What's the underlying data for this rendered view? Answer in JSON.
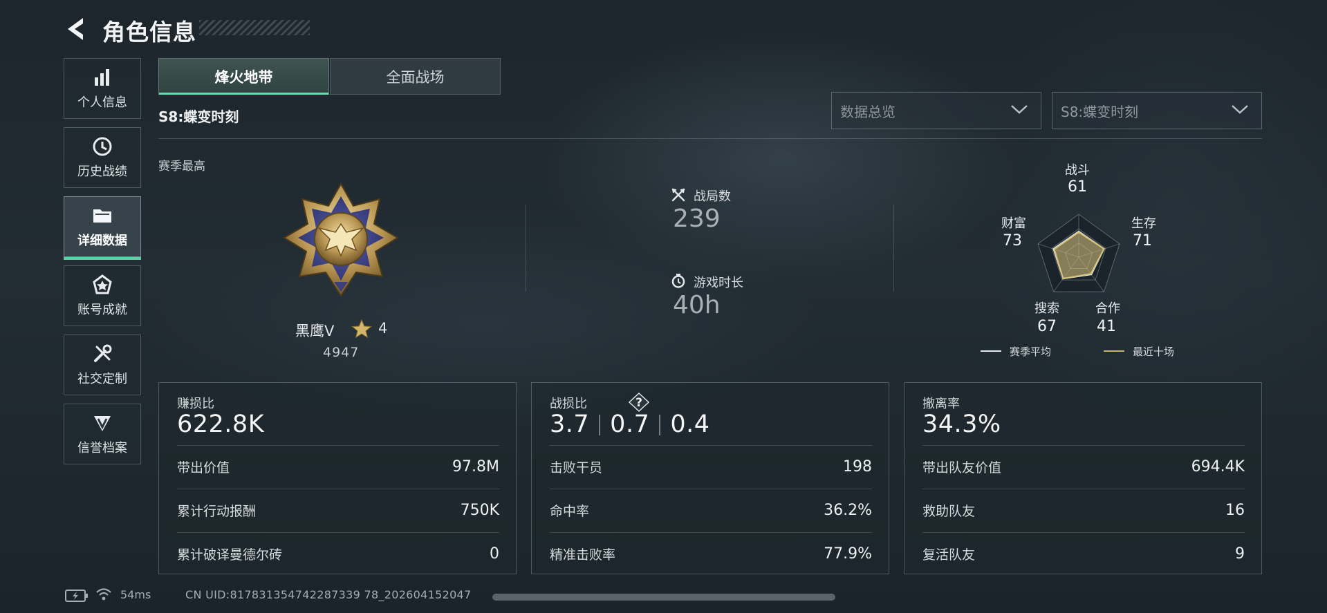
{
  "header": {
    "title": "角色信息"
  },
  "sidebar": {
    "items": [
      {
        "label": "个人信息",
        "icon": "bar-chart-icon"
      },
      {
        "label": "历史战绩",
        "icon": "clock-icon"
      },
      {
        "label": "详细数据",
        "icon": "folder-icon",
        "active": true
      },
      {
        "label": "账号成就",
        "icon": "achievement-icon"
      },
      {
        "label": "社交定制",
        "icon": "tools-icon"
      },
      {
        "label": "信誉档案",
        "icon": "credit-shield-icon"
      }
    ]
  },
  "tabs": [
    {
      "label": "烽火地带",
      "active": true
    },
    {
      "label": "全面战场",
      "active": false
    }
  ],
  "season_title": "S8:蝶变时刻",
  "filters": {
    "view": "数据总览",
    "season": "S8:蝶变时刻"
  },
  "season_best": {
    "label": "赛季最高",
    "rank_name": "黑鹰V",
    "stars": "4",
    "score": "4947"
  },
  "stats": {
    "matches_label": "战局数",
    "matches_value": "239",
    "playtime_label": "游戏时长",
    "playtime_value": "40h"
  },
  "radar": {
    "axes": [
      {
        "label": "战斗",
        "value": "61"
      },
      {
        "label": "生存",
        "value": "71"
      },
      {
        "label": "合作",
        "value": "41"
      },
      {
        "label": "搜索",
        "value": "67"
      },
      {
        "label": "财富",
        "value": "73"
      }
    ],
    "season_avg": [
      0.6,
      0.62,
      0.5,
      0.62,
      0.62
    ],
    "recent_ten": [
      0.58,
      0.62,
      0.48,
      0.62,
      0.6
    ],
    "legend": {
      "season_avg": "赛季平均",
      "recent_ten": "最近十场"
    },
    "colors": {
      "season_avg": "#e6eaec",
      "recent_ten": "#c9b56a"
    }
  },
  "panels": {
    "profit": {
      "title": "赚损比",
      "big": "622.8K",
      "rows": [
        {
          "label": "带出价值",
          "value": "97.8M"
        },
        {
          "label": "累计行动报酬",
          "value": "750K"
        },
        {
          "label": "累计破译曼德尔砖",
          "value": "0"
        }
      ]
    },
    "kd": {
      "title": "战损比",
      "help": "?",
      "big": [
        "3.7",
        "0.7",
        "0.4"
      ],
      "rows": [
        {
          "label": "击败干员",
          "value": "198"
        },
        {
          "label": "命中率",
          "value": "36.2%"
        },
        {
          "label": "精准击败率",
          "value": "77.9%"
        }
      ]
    },
    "extract": {
      "title": "撤离率",
      "big": "34.3%",
      "rows": [
        {
          "label": "带出队友价值",
          "value": "694.4K"
        },
        {
          "label": "救助队友",
          "value": "16"
        },
        {
          "label": "复活队友",
          "value": "9"
        }
      ]
    }
  },
  "footer": {
    "ping": "54ms",
    "uid": "CN UID:817831354742287339 78_202604152047"
  },
  "accent": "#58d2a4"
}
